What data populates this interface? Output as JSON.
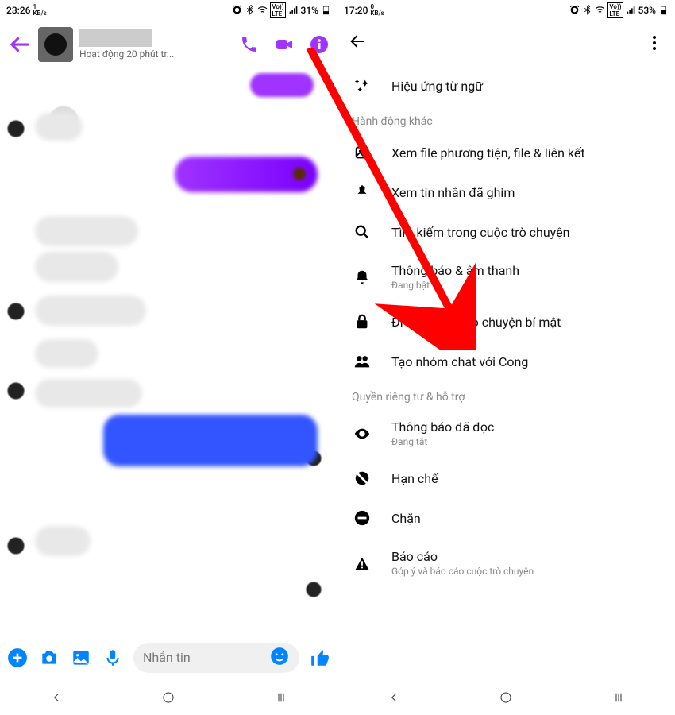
{
  "left": {
    "status": {
      "time": "23:26",
      "speed_num": "1",
      "speed_unit": "KB/s",
      "battery": "31%"
    },
    "header": {
      "activity": "Hoạt động 20 phút tr..."
    },
    "composer": {
      "placeholder": "Nhắn tin"
    }
  },
  "right": {
    "status": {
      "time": "17:20",
      "speed_num": "0",
      "speed_unit": "KB/s",
      "battery": "53%"
    },
    "section_customize": "",
    "row_effects": "Hiệu ứng từ ngữ",
    "section_more": "Hành động khác",
    "row_media": "Xem file phương tiện, file & liên kết",
    "row_pinned": "Xem tin nhắn đã ghim",
    "row_search": "Tìm kiếm trong cuộc trò chuyện",
    "row_notif": "Thông báo & âm thanh",
    "row_notif_sub": "Đang bật",
    "row_secret": "Đi đến Cuộc trò chuyện bí mật",
    "row_group": "Tạo nhóm chat với Cong",
    "section_privacy": "Quyền riêng tư & hỗ trợ",
    "row_read": "Thông báo đã đọc",
    "row_read_sub": "Đang tắt",
    "row_restrict": "Hạn chế",
    "row_block": "Chặn",
    "row_report": "Báo cáo",
    "row_report_sub": "Góp ý và báo cáo cuộc trò chuyện"
  }
}
